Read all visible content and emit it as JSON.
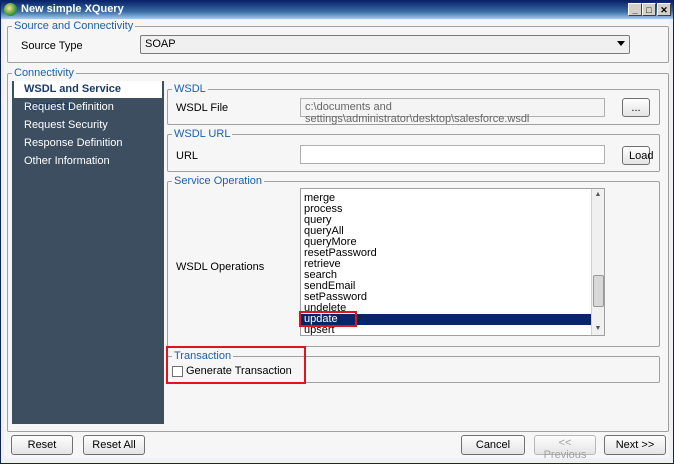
{
  "window": {
    "title": "New simple XQuery"
  },
  "source_group": {
    "legend": "Source and Connectivity",
    "source_type_label": "Source Type",
    "source_type_value": "SOAP"
  },
  "connectivity": {
    "legend": "Connectivity"
  },
  "nav": {
    "items": [
      {
        "label": "WSDL and Service Operation",
        "active": true
      },
      {
        "label": "Request Definition"
      },
      {
        "label": "Request Security"
      },
      {
        "label": "Response Definition"
      },
      {
        "label": "Other Information"
      }
    ]
  },
  "wsdl": {
    "legend": "WSDL",
    "file_label": "WSDL File",
    "file_value": "c:\\documents and settings\\administrator\\desktop\\salesforce.wsdl",
    "browse_label": "..."
  },
  "wsdl_url": {
    "legend": "WSDL URL",
    "url_label": "URL",
    "url_value": "",
    "load_label": "Load"
  },
  "service": {
    "legend": "Service Operation",
    "ops_label": "WSDL Operations",
    "operations": [
      "merge",
      "process",
      "query",
      "queryAll",
      "queryMore",
      "resetPassword",
      "retrieve",
      "search",
      "sendEmail",
      "setPassword",
      "undelete",
      "update",
      "upsert"
    ],
    "selected": "update"
  },
  "transaction": {
    "legend": "Transaction",
    "checkbox_label": "Generate Transaction",
    "checked": false
  },
  "footer": {
    "reset": "Reset",
    "reset_all": "Reset All",
    "cancel": "Cancel",
    "previous": "<< Previous",
    "next": "Next >>"
  },
  "colors": {
    "title_bar": "#0a246a",
    "nav_bg": "#3c4e60",
    "legend": "#1a5fb4",
    "highlight": "#e0141e",
    "selection": "#0a246a"
  }
}
